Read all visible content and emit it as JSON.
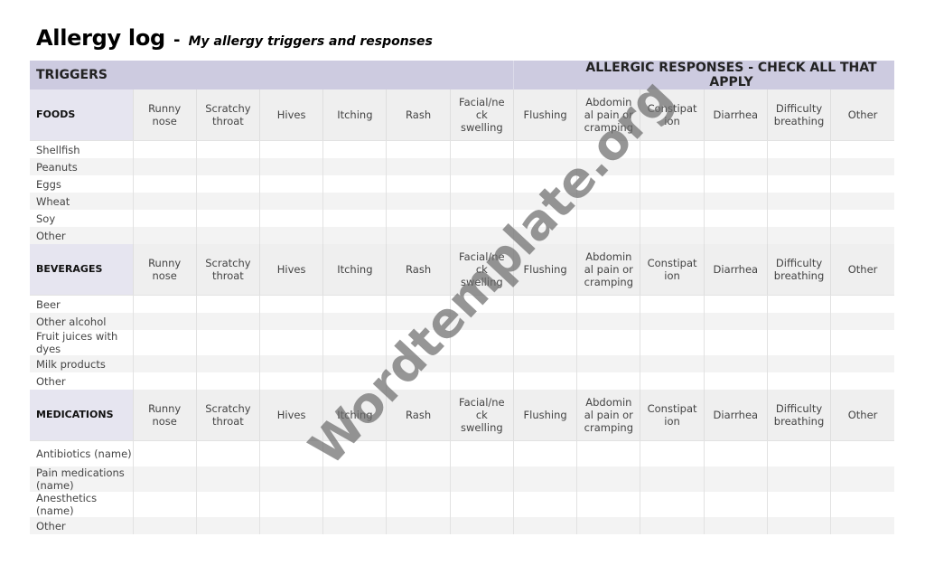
{
  "title": {
    "main": "Allergy log",
    "separator": "-",
    "subtitle": "My allergy triggers and responses"
  },
  "band": {
    "triggers": "TRIGGERS",
    "responses": "ALLERGIC RESPONSES - CHECK ALL THAT APPLY"
  },
  "response_columns": [
    "Runny nose",
    "Scratchy throat",
    "Hives",
    "Itching",
    "Rash",
    "Facial/neck swelling",
    "Flushing",
    "Abdominal pain or cramping",
    "Constipation",
    "Diarrhea",
    "Difficulty breathing",
    "Other"
  ],
  "response_columns_display": [
    "Runny\nnose",
    "Scratchy\nthroat",
    "Hives",
    "Itching",
    "Rash",
    "Facial/ne\nck\nswelling",
    "Flushing",
    "Abdomin\nal pain or\ncramping",
    "Constipat\nion",
    "Diarrhea",
    "Difficulty\nbreathing",
    "Other"
  ],
  "sections": [
    {
      "category": "FOODS",
      "rows": [
        "Shellfish",
        "Peanuts",
        "Eggs",
        "Wheat",
        "Soy",
        "Other"
      ]
    },
    {
      "category": "BEVERAGES",
      "rows": [
        "Beer",
        "Other alcohol",
        "Fruit juices with dyes",
        "Milk products",
        "Other"
      ]
    },
    {
      "category": "MEDICATIONS",
      "rows": [
        "Antibiotics (name)",
        "Pain medications (name)",
        "Anesthetics (name)",
        "Other"
      ]
    }
  ],
  "watermark": "Wordtemplate.org",
  "colors": {
    "band": "#cdcbe0",
    "category_cell": "#e6e5f0",
    "header_cell": "#efefef",
    "stripe": "#f3f3f3"
  }
}
